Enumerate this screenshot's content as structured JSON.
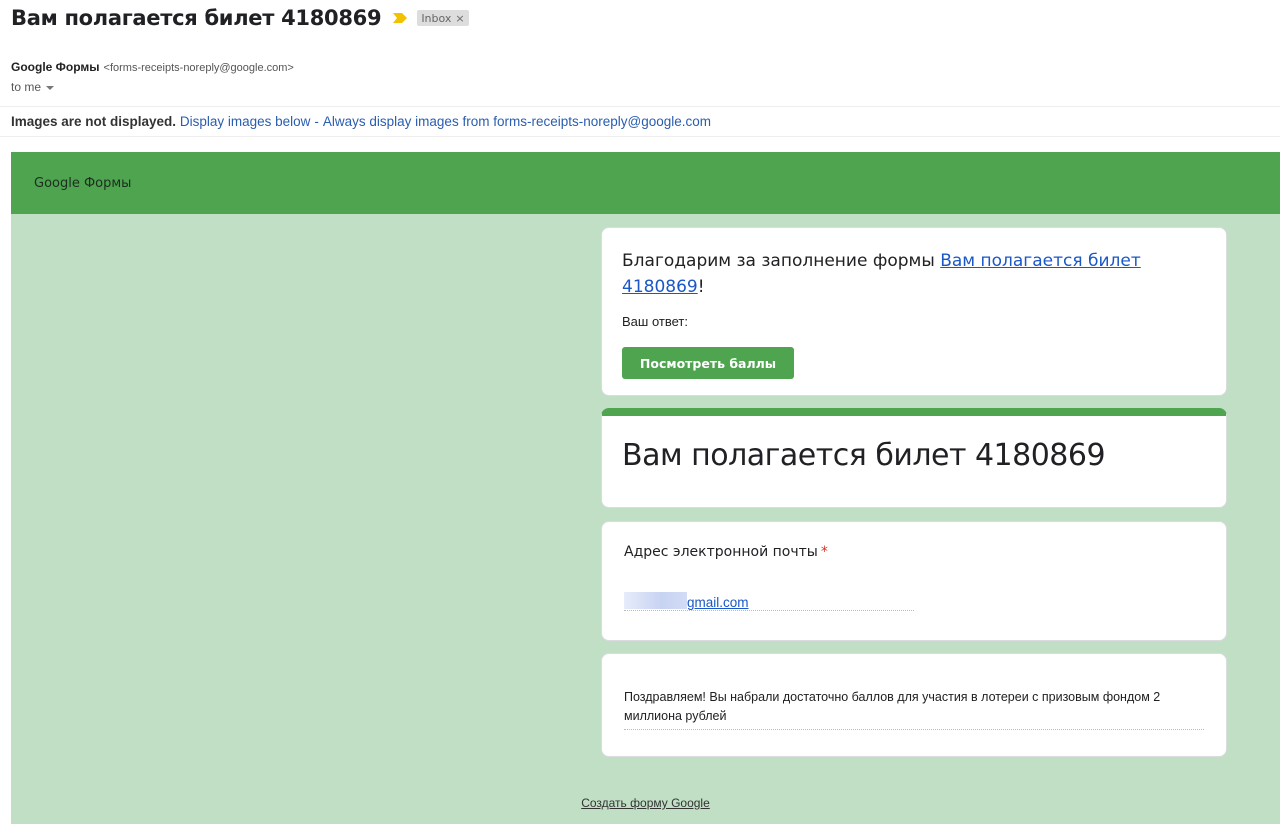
{
  "header": {
    "subject": "Вам полагается билет 4180869",
    "label": "Inbox",
    "label_close": "×",
    "importance_color": "#f2c200"
  },
  "sender": {
    "name": "Google Формы",
    "email": "<forms-receipts-noreply@google.com>",
    "to": "to me"
  },
  "images_bar": {
    "notice": "Images are not displayed.",
    "display_below": "Display images below",
    "separator": "-",
    "always_display": "Always display images from forms-receipts-noreply@google.com"
  },
  "form_email": {
    "brand": "Google Формы",
    "colors": {
      "header_green": "#4ea44f",
      "background_green": "#c0dfc4",
      "link_blue": "#1a57c7"
    },
    "thanks_prefix": "Благодарим за заполнение формы ",
    "thanks_link": "Вам полагается билет 4180869",
    "thanks_suffix": "!",
    "your_answer": "Ваш ответ:",
    "view_score_button": "Посмотреть баллы",
    "form_title": "Вам полагается билет 4180869",
    "email_question": "Адрес электронной почты",
    "required_mark": "*",
    "email_answer_visible": "gmail.com",
    "congrats_text": "Поздравляем! Вы набрали достаточно баллов для участия в лотереи с призовым фондом 2 миллиона рублей",
    "footer_link": "Создать форму Google"
  }
}
